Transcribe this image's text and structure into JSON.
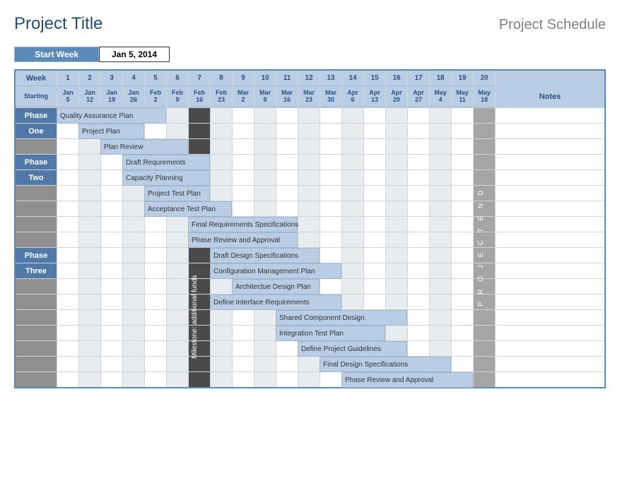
{
  "title": "Project Title",
  "subtitle": "Project Schedule",
  "start_week_label": "Start Week",
  "start_week_value": "Jan 5, 2014",
  "header": {
    "week_label": "Week",
    "starting_label": "Starting",
    "notes_label": "Notes"
  },
  "weeks": [
    {
      "n": "1",
      "m": "Jan",
      "d": "5"
    },
    {
      "n": "2",
      "m": "Jan",
      "d": "12"
    },
    {
      "n": "3",
      "m": "Jan",
      "d": "19"
    },
    {
      "n": "4",
      "m": "Jan",
      "d": "26"
    },
    {
      "n": "5",
      "m": "Feb",
      "d": "2"
    },
    {
      "n": "6",
      "m": "Feb",
      "d": "9"
    },
    {
      "n": "7",
      "m": "Feb",
      "d": "16"
    },
    {
      "n": "8",
      "m": "Feb",
      "d": "23"
    },
    {
      "n": "9",
      "m": "Mar",
      "d": "2"
    },
    {
      "n": "10",
      "m": "Mar",
      "d": "9"
    },
    {
      "n": "11",
      "m": "Mar",
      "d": "16"
    },
    {
      "n": "12",
      "m": "Mar",
      "d": "23"
    },
    {
      "n": "13",
      "m": "Mar",
      "d": "30"
    },
    {
      "n": "14",
      "m": "Apr",
      "d": "6"
    },
    {
      "n": "15",
      "m": "Apr",
      "d": "13"
    },
    {
      "n": "16",
      "m": "Apr",
      "d": "20"
    },
    {
      "n": "17",
      "m": "Apr",
      "d": "27"
    },
    {
      "n": "18",
      "m": "May",
      "d": "4"
    },
    {
      "n": "19",
      "m": "May",
      "d": "11"
    },
    {
      "n": "20",
      "m": "May",
      "d": "18"
    }
  ],
  "milestone_col": 7,
  "milestone_label": "Milestone: additional funds",
  "end_col": 20,
  "end_label": "PROJECT END",
  "phases": [
    {
      "name": "Phase",
      "sub": "One",
      "tasks": [
        {
          "label": "Quality Assurance Plan",
          "start": 1,
          "dur": 5
        },
        {
          "label": "Project Plan",
          "start": 2,
          "dur": 3
        },
        {
          "label": "Plan Review",
          "start": 3,
          "dur": 4
        }
      ]
    },
    {
      "name": "Phase",
      "sub": "Two",
      "tasks": [
        {
          "label": "Draft Requrements",
          "start": 4,
          "dur": 4
        },
        {
          "label": "Capacity Planning",
          "start": 4,
          "dur": 4
        },
        {
          "label": "Project Test Plan",
          "start": 5,
          "dur": 3
        },
        {
          "label": "Acceptance Test Plan",
          "start": 5,
          "dur": 4
        },
        {
          "label": "Final Requirements Specifications",
          "start": 7,
          "dur": 5
        },
        {
          "label": "Phase Review and Approval",
          "start": 7,
          "dur": 5
        }
      ]
    },
    {
      "name": "Phase",
      "sub": "Three",
      "tasks": [
        {
          "label": "Draft Design Specifications",
          "start": 8,
          "dur": 5
        },
        {
          "label": "Configuration Management Plan",
          "start": 8,
          "dur": 6
        },
        {
          "label": "Architectue Design Plan",
          "start": 9,
          "dur": 4
        },
        {
          "label": "Define Interface Requirements",
          "start": 8,
          "dur": 6
        },
        {
          "label": "Shared Component Design",
          "start": 11,
          "dur": 6
        },
        {
          "label": "Integration Test Plan",
          "start": 11,
          "dur": 5
        },
        {
          "label": "Define Project Guidelines",
          "start": 12,
          "dur": 5
        },
        {
          "label": "Final Design Specifications",
          "start": 13,
          "dur": 6
        },
        {
          "label": "Phase Review and Approval",
          "start": 14,
          "dur": 6
        }
      ]
    }
  ],
  "chart_data": {
    "type": "bar",
    "title": "Project Schedule",
    "xlabel": "Week",
    "ylabel": "",
    "categories": [
      "1",
      "2",
      "3",
      "4",
      "5",
      "6",
      "7",
      "8",
      "9",
      "10",
      "11",
      "12",
      "13",
      "14",
      "15",
      "16",
      "17",
      "18",
      "19",
      "20"
    ],
    "series": [
      {
        "name": "Quality Assurance Plan",
        "start": 1,
        "end": 5,
        "phase": "Phase One"
      },
      {
        "name": "Project Plan",
        "start": 2,
        "end": 4,
        "phase": "Phase One"
      },
      {
        "name": "Plan Review",
        "start": 3,
        "end": 6,
        "phase": "Phase One"
      },
      {
        "name": "Draft Requrements",
        "start": 4,
        "end": 7,
        "phase": "Phase Two"
      },
      {
        "name": "Capacity Planning",
        "start": 4,
        "end": 7,
        "phase": "Phase Two"
      },
      {
        "name": "Project Test Plan",
        "start": 5,
        "end": 7,
        "phase": "Phase Two"
      },
      {
        "name": "Acceptance Test Plan",
        "start": 5,
        "end": 8,
        "phase": "Phase Two"
      },
      {
        "name": "Final Requirements Specifications",
        "start": 7,
        "end": 11,
        "phase": "Phase Two"
      },
      {
        "name": "Phase Review and Approval",
        "start": 7,
        "end": 11,
        "phase": "Phase Two"
      },
      {
        "name": "Draft Design Specifications",
        "start": 8,
        "end": 12,
        "phase": "Phase Three"
      },
      {
        "name": "Configuration Management Plan",
        "start": 8,
        "end": 13,
        "phase": "Phase Three"
      },
      {
        "name": "Architectue Design Plan",
        "start": 9,
        "end": 12,
        "phase": "Phase Three"
      },
      {
        "name": "Define Interface Requirements",
        "start": 8,
        "end": 13,
        "phase": "Phase Three"
      },
      {
        "name": "Shared Component Design",
        "start": 11,
        "end": 16,
        "phase": "Phase Three"
      },
      {
        "name": "Integration Test Plan",
        "start": 11,
        "end": 15,
        "phase": "Phase Three"
      },
      {
        "name": "Define Project Guidelines",
        "start": 12,
        "end": 16,
        "phase": "Phase Three"
      },
      {
        "name": "Final Design Specifications",
        "start": 13,
        "end": 18,
        "phase": "Phase Three"
      },
      {
        "name": "Phase Review and Approval",
        "start": 14,
        "end": 19,
        "phase": "Phase Three"
      }
    ],
    "milestones": [
      {
        "name": "Milestone: additional funds",
        "week": 7
      }
    ],
    "end_marker": {
      "name": "PROJECT END",
      "week": 20
    }
  }
}
